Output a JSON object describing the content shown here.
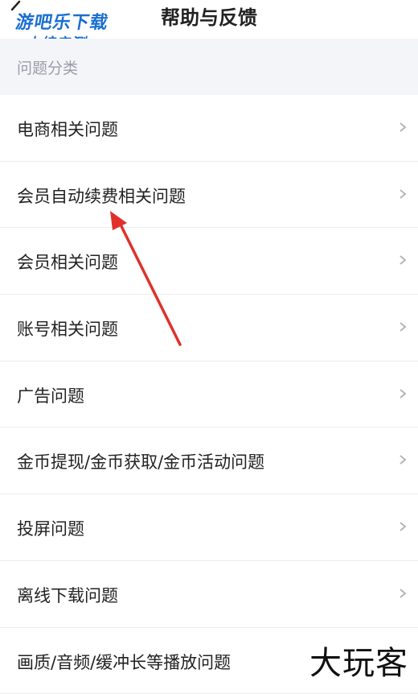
{
  "header": {
    "title": "帮助与反馈"
  },
  "watermark_top": {
    "line1": "游吧乐下载",
    "line2": "小编亲测"
  },
  "section": {
    "title": "问题分类"
  },
  "items": [
    {
      "label": "电商相关问题"
    },
    {
      "label": "会员自动续费相关问题"
    },
    {
      "label": "会员相关问题"
    },
    {
      "label": "账号相关问题"
    },
    {
      "label": "广告问题"
    },
    {
      "label": "金币提现/金币获取/金币活动问题"
    },
    {
      "label": "投屏问题"
    },
    {
      "label": "离线下载问题"
    },
    {
      "label": "画质/音频/缓冲长等播放问题"
    }
  ],
  "watermark_bottom": {
    "text": "大玩客"
  },
  "icons": {
    "back": "back-arrow-icon",
    "chevron": "chevron-right-icon"
  },
  "colors": {
    "section_bg": "#f3f5f9",
    "section_text": "#9a9ea6",
    "arrow": "#e0302a",
    "watermark_blue": "#1a6fd1"
  }
}
